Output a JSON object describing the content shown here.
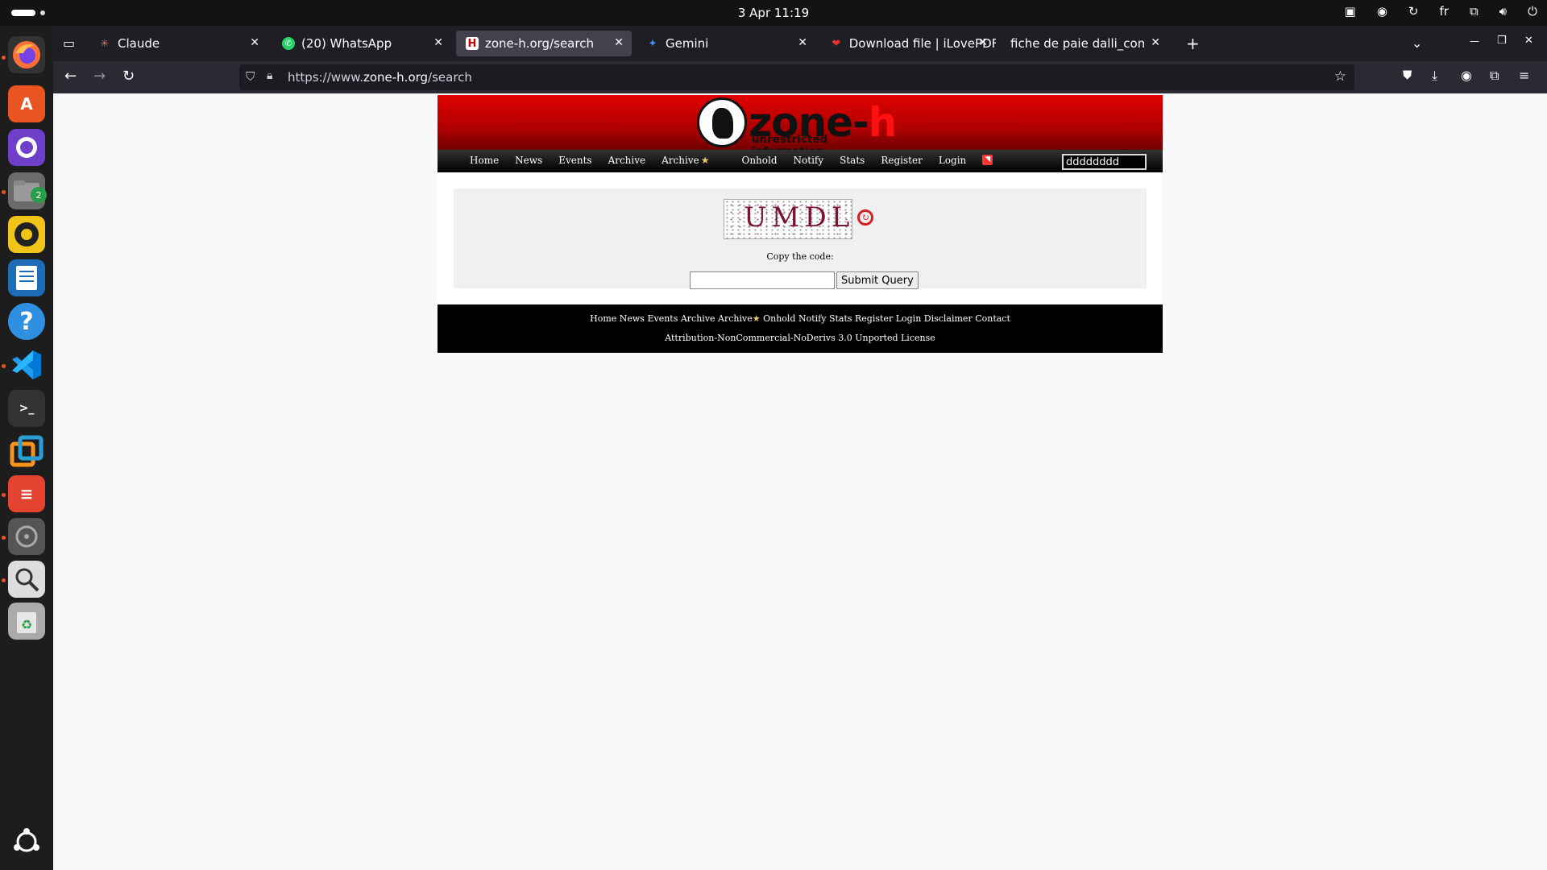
{
  "system": {
    "clock": "3 Apr  11:19",
    "language": "fr"
  },
  "dock": {
    "files_badge": "2"
  },
  "browser": {
    "tabs": [
      {
        "title": "Claude",
        "icon": "claude-icon"
      },
      {
        "title": "(20) WhatsApp",
        "icon": "whatsapp-icon"
      },
      {
        "title": "zone-h.org/search",
        "icon": "zone-h-icon"
      },
      {
        "title": "Gemini",
        "icon": "gemini-icon"
      },
      {
        "title": "Download file | iLovePDF",
        "icon": "ilovepdf-icon"
      },
      {
        "title": "fiche de paie dalli_compresse",
        "icon": ""
      }
    ],
    "url_prefix": "https://www.",
    "url_domain": "zone-h.org",
    "url_path": "/search"
  },
  "site": {
    "logo_word_main": "zone-",
    "logo_word_h": "h",
    "logo_tagline": "unrestricted information",
    "menu": [
      "Home",
      "News",
      "Events",
      "Archive",
      "Archive",
      "Onhold",
      "Notify",
      "Stats",
      "Register",
      "Login"
    ],
    "search_value": "dddddddd",
    "captcha_text": "UMDL",
    "copy_label": "Copy the code:",
    "submit_label": "Submit Query",
    "footer_links_a": "Home News Events Archive Archive",
    "footer_links_b": "Onhold Notify Stats Register Login Disclaimer Contact",
    "license": "Attribution-NonCommercial-NoDerivs 3.0 Unported License"
  }
}
